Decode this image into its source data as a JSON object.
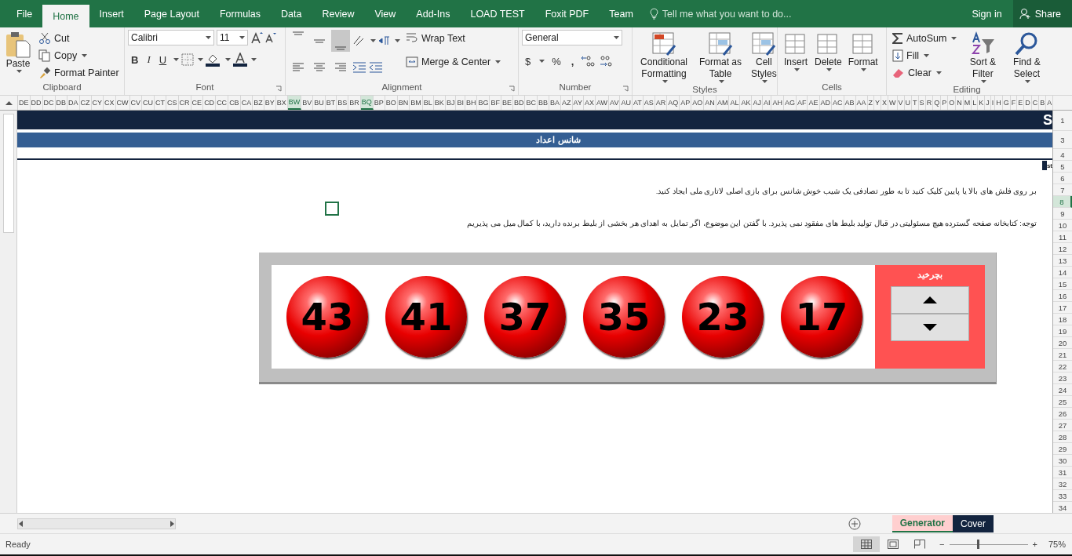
{
  "ribbon_tabs": [
    {
      "label": "File",
      "selected": false
    },
    {
      "label": "Home",
      "selected": true
    },
    {
      "label": "Insert",
      "selected": false
    },
    {
      "label": "Page Layout",
      "selected": false
    },
    {
      "label": "Formulas",
      "selected": false
    },
    {
      "label": "Data",
      "selected": false
    },
    {
      "label": "Review",
      "selected": false
    },
    {
      "label": "View",
      "selected": false
    },
    {
      "label": "Add-Ins",
      "selected": false
    },
    {
      "label": "LOAD TEST",
      "selected": false
    },
    {
      "label": "Foxit PDF",
      "selected": false
    },
    {
      "label": "Team",
      "selected": false
    }
  ],
  "tell_me": {
    "placeholder": "Tell me what you want to do..."
  },
  "account": {
    "sign_in": "Sign in",
    "share": "Share"
  },
  "ribbon": {
    "clipboard": {
      "label": "Clipboard",
      "paste": "Paste",
      "cut": "Cut",
      "copy": "Copy",
      "format_painter": "Format Painter"
    },
    "font": {
      "label": "Font",
      "family": "Calibri",
      "size": "11",
      "bold": "B",
      "italic": "I",
      "underline": "U"
    },
    "alignment": {
      "label": "Alignment",
      "wrap_text": "Wrap Text",
      "merge_center": "Merge & Center"
    },
    "number": {
      "label": "Number",
      "format": "General",
      "currency": "$",
      "percent": "%",
      "comma": ","
    },
    "styles": {
      "label": "Styles",
      "buttons": [
        "Conditional Formatting",
        "Format as Table",
        "Cell Styles"
      ]
    },
    "cells": {
      "label": "Cells",
      "buttons": [
        "Insert",
        "Delete",
        "Format"
      ]
    },
    "editing": {
      "label": "Editing",
      "autosum": "AutoSum",
      "fill": "Fill",
      "clear": "Clear",
      "sort_filter": "Sort & Filter",
      "find_select": "Find & Select"
    }
  },
  "column_headers": [
    {
      "label": "DE",
      "selected": false
    },
    {
      "label": "DD",
      "selected": false
    },
    {
      "label": "DC",
      "selected": false
    },
    {
      "label": "DB",
      "selected": false
    },
    {
      "label": "DA",
      "selected": false
    },
    {
      "label": "CZ",
      "selected": false
    },
    {
      "label": "CY",
      "selected": false
    },
    {
      "label": "CX",
      "selected": false
    },
    {
      "label": "CW",
      "selected": false
    },
    {
      "label": "CV",
      "selected": false
    },
    {
      "label": "CU",
      "selected": false
    },
    {
      "label": "CT",
      "selected": false
    },
    {
      "label": "CS",
      "selected": false
    },
    {
      "label": "CR",
      "selected": false
    },
    {
      "label": "CE",
      "selected": false
    },
    {
      "label": "CD",
      "selected": false
    },
    {
      "label": "CC",
      "selected": false
    },
    {
      "label": "CB",
      "selected": false
    },
    {
      "label": "CA",
      "selected": false
    },
    {
      "label": "BZ",
      "selected": false
    },
    {
      "label": "BY",
      "selected": false
    },
    {
      "label": "BX",
      "selected": false
    },
    {
      "label": "BW",
      "selected": true
    },
    {
      "label": "BV",
      "selected": false
    },
    {
      "label": "BU",
      "selected": false
    },
    {
      "label": "BT",
      "selected": false
    },
    {
      "label": "BS",
      "selected": false
    },
    {
      "label": "BR",
      "selected": false
    },
    {
      "label": "BQ",
      "selected": true
    },
    {
      "label": "BP",
      "selected": false
    },
    {
      "label": "BO",
      "selected": false
    },
    {
      "label": "BN",
      "selected": false
    },
    {
      "label": "BM",
      "selected": false
    },
    {
      "label": "BL",
      "selected": false
    },
    {
      "label": "BK",
      "selected": false
    },
    {
      "label": "BJ",
      "selected": false
    },
    {
      "label": "BI",
      "selected": false
    },
    {
      "label": "BH",
      "selected": false
    },
    {
      "label": "BG",
      "selected": false
    },
    {
      "label": "BF",
      "selected": false
    },
    {
      "label": "BE",
      "selected": false
    },
    {
      "label": "BD",
      "selected": false
    },
    {
      "label": "BC",
      "selected": false
    },
    {
      "label": "BB",
      "selected": false
    },
    {
      "label": "BA",
      "selected": false
    },
    {
      "label": "AZ",
      "selected": false
    },
    {
      "label": "AY",
      "selected": false
    },
    {
      "label": "AX",
      "selected": false
    },
    {
      "label": "AW",
      "selected": false
    },
    {
      "label": "AV",
      "selected": false
    },
    {
      "label": "AU",
      "selected": false
    },
    {
      "label": "AT",
      "selected": false
    },
    {
      "label": "AS",
      "selected": false
    },
    {
      "label": "AR",
      "selected": false
    },
    {
      "label": "AQ",
      "selected": false
    },
    {
      "label": "AP",
      "selected": false
    },
    {
      "label": "AO",
      "selected": false
    },
    {
      "label": "AN",
      "selected": false
    },
    {
      "label": "AM",
      "selected": false
    },
    {
      "label": "AL",
      "selected": false
    },
    {
      "label": "AK",
      "selected": false
    },
    {
      "label": "AJ",
      "selected": false
    },
    {
      "label": "AI",
      "selected": false
    },
    {
      "label": "AH",
      "selected": false
    },
    {
      "label": "AG",
      "selected": false
    },
    {
      "label": "AF",
      "selected": false
    },
    {
      "label": "AE",
      "selected": false
    },
    {
      "label": "AD",
      "selected": false
    },
    {
      "label": "AC",
      "selected": false
    },
    {
      "label": "AB",
      "selected": false
    },
    {
      "label": "AA",
      "selected": false
    },
    {
      "label": "Z",
      "selected": false
    },
    {
      "label": "Y",
      "selected": false
    },
    {
      "label": "X",
      "selected": false
    },
    {
      "label": "W",
      "selected": false
    },
    {
      "label": "V",
      "selected": false
    },
    {
      "label": "U",
      "selected": false
    },
    {
      "label": "T",
      "selected": false
    },
    {
      "label": "S",
      "selected": false
    },
    {
      "label": "R",
      "selected": false
    },
    {
      "label": "Q",
      "selected": false
    },
    {
      "label": "P",
      "selected": false
    },
    {
      "label": "O",
      "selected": false
    },
    {
      "label": "N",
      "selected": false
    },
    {
      "label": "M",
      "selected": false
    },
    {
      "label": "L",
      "selected": false
    },
    {
      "label": "K",
      "selected": false
    },
    {
      "label": "J",
      "selected": false
    },
    {
      "label": "I",
      "selected": false
    },
    {
      "label": "H",
      "selected": false
    },
    {
      "label": "G",
      "selected": false
    },
    {
      "label": "F",
      "selected": false
    },
    {
      "label": "E",
      "selected": false
    },
    {
      "label": "D",
      "selected": false
    },
    {
      "label": "C",
      "selected": false
    },
    {
      "label": "B",
      "selected": false
    },
    {
      "label": "A",
      "selected": false
    }
  ],
  "row_headers": [
    {
      "label": "1",
      "selected": false
    },
    {
      "label": "3",
      "selected": false
    },
    {
      "label": "4",
      "selected": false
    },
    {
      "label": "5",
      "selected": false
    },
    {
      "label": "6",
      "selected": false
    },
    {
      "label": "7",
      "selected": false
    },
    {
      "label": "8",
      "selected": true
    },
    {
      "label": "9",
      "selected": false
    },
    {
      "label": "10",
      "selected": false
    },
    {
      "label": "11",
      "selected": false
    },
    {
      "label": "12",
      "selected": false
    },
    {
      "label": "13",
      "selected": false
    },
    {
      "label": "14",
      "selected": false
    },
    {
      "label": "15",
      "selected": false
    },
    {
      "label": "16",
      "selected": false
    },
    {
      "label": "17",
      "selected": false
    },
    {
      "label": "18",
      "selected": false
    },
    {
      "label": "19",
      "selected": false
    },
    {
      "label": "20",
      "selected": false
    },
    {
      "label": "21",
      "selected": false
    },
    {
      "label": "22",
      "selected": false
    },
    {
      "label": "23",
      "selected": false
    },
    {
      "label": "24",
      "selected": false
    },
    {
      "label": "25",
      "selected": false
    },
    {
      "label": "26",
      "selected": false
    },
    {
      "label": "27",
      "selected": false
    },
    {
      "label": "28",
      "selected": false
    },
    {
      "label": "29",
      "selected": false
    },
    {
      "label": "30",
      "selected": false
    },
    {
      "label": "31",
      "selected": false
    },
    {
      "label": "32",
      "selected": false
    },
    {
      "label": "33",
      "selected": false
    },
    {
      "label": "34",
      "selected": false
    }
  ],
  "sheet": {
    "title_initial": "S",
    "heading": "شانس اعداد",
    "cell_fragment": "st",
    "instructions": "بر روی فلش های بالا یا پایین کلیک کنید تا به طور تصادفی یک شیب خوش شانس برای بازی اصلی لاتاری ملی ایجاد کنید.",
    "note": "توجه: کتابخانه صفحه گسترده هیچ مسئولیتی در قبال تولید بلیط های مفقود نمی پذیرد. با گفتن این موضوع، اگر تمایل به اهدای هر بخشی از بلیط برنده دارید، با کمال میل می پذیریم",
    "generator": {
      "numbers": [
        "43",
        "41",
        "37",
        "35",
        "23",
        "17"
      ],
      "spin_label": "بچرخید"
    }
  },
  "sheet_tabs": [
    {
      "label": "Generator",
      "selected": true
    },
    {
      "label": "Cover",
      "selected": false
    }
  ],
  "status_bar": {
    "status": "Ready",
    "zoom": {
      "zoom_out": "−",
      "zoom_in": "+",
      "level": 0.35,
      "reading": "75%"
    }
  }
}
